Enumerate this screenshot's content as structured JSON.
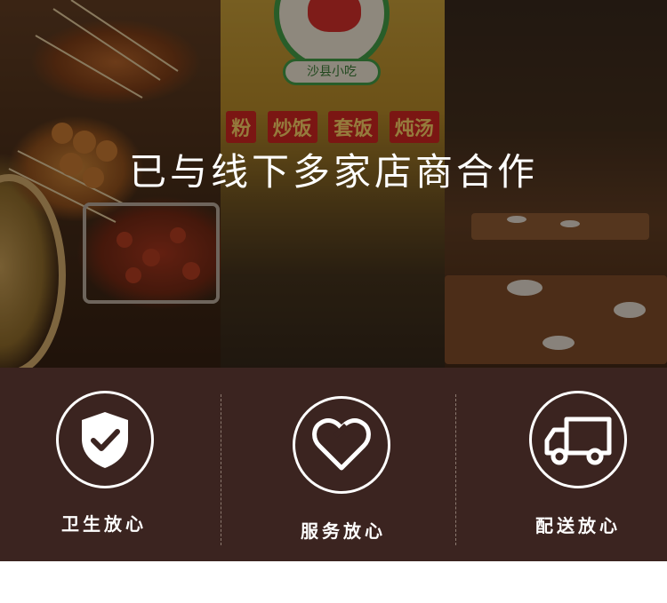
{
  "hero": {
    "headline": "已与线下多家店商合作",
    "sign_sub": "沙县小吃",
    "menu_words": [
      "粉",
      "炒饭",
      "套饭",
      "炖汤"
    ]
  },
  "features": [
    {
      "label": "卫生放心",
      "icon": "shield-check-icon"
    },
    {
      "label": "服务放心",
      "icon": "heart-icon"
    },
    {
      "label": "配送放心",
      "icon": "truck-icon"
    }
  ],
  "colors": {
    "band_background": "#3b2420",
    "icon_stroke": "#ffffff",
    "text": "#ffffff"
  }
}
